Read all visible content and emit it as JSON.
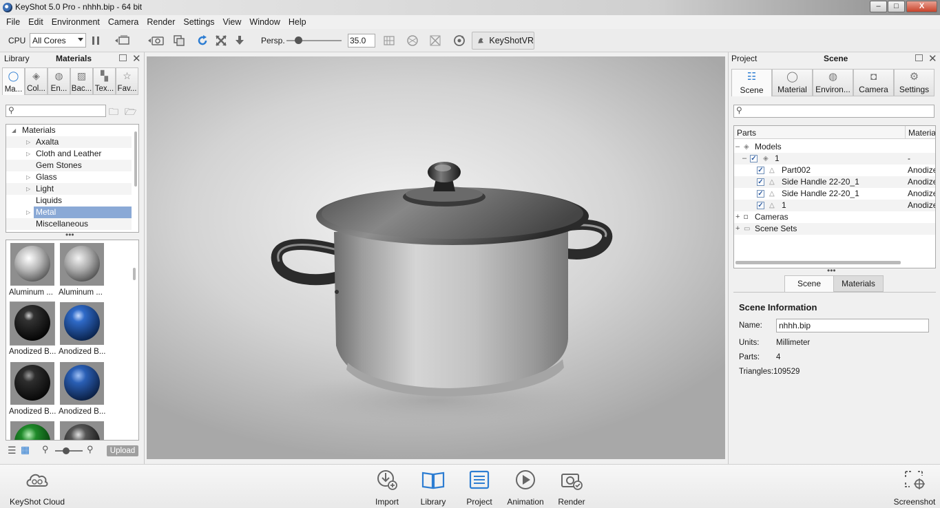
{
  "window": {
    "title": "KeyShot 5.0 Pro  - nhhh.bip  - 64 bit",
    "minimize": "–",
    "maximize": "□",
    "close": "X"
  },
  "menubar": [
    "File",
    "Edit",
    "Environment",
    "Camera",
    "Render",
    "Settings",
    "View",
    "Window",
    "Help"
  ],
  "toolbar": {
    "cpu_label": "CPU",
    "cpu_value": "All Cores",
    "persp_label": "Persp.",
    "persp_value": "35.0",
    "keyshotvr_label": "KeyShotVR"
  },
  "library": {
    "header_left": "Library",
    "header_center": "Materials",
    "tabs": [
      {
        "label": "Ma...",
        "icon": "material-icon"
      },
      {
        "label": "Col...",
        "icon": "colors-icon"
      },
      {
        "label": "En...",
        "icon": "environment-icon"
      },
      {
        "label": "Bac...",
        "icon": "backplate-icon"
      },
      {
        "label": "Tex...",
        "icon": "texture-icon"
      },
      {
        "label": "Fav...",
        "icon": "favorites-icon"
      }
    ],
    "tree": [
      {
        "label": "Materials",
        "level": 0,
        "arrow": "down"
      },
      {
        "label": "Axalta",
        "level": 1,
        "arrow": "right"
      },
      {
        "label": "Cloth and Leather",
        "level": 1,
        "arrow": "right"
      },
      {
        "label": "Gem Stones",
        "level": 1,
        "arrow": ""
      },
      {
        "label": "Glass",
        "level": 1,
        "arrow": "right"
      },
      {
        "label": "Light",
        "level": 1,
        "arrow": "right"
      },
      {
        "label": "Liquids",
        "level": 1,
        "arrow": ""
      },
      {
        "label": "Metal",
        "level": 1,
        "arrow": "right",
        "selected": true
      },
      {
        "label": "Miscellaneous",
        "level": 1,
        "arrow": ""
      }
    ],
    "thumbnails": [
      {
        "caption": "Aluminum ...",
        "color": "#c9c9c9"
      },
      {
        "caption": "Aluminum ...",
        "color": "#bdbdbd"
      },
      {
        "caption": "Anodized B...",
        "color": "#1a1a1a"
      },
      {
        "caption": "Anodized B...",
        "color": "#1d4f9e"
      },
      {
        "caption": "Anodized B...",
        "color": "#222222"
      },
      {
        "caption": "Anodized B...",
        "color": "#2557a8"
      },
      {
        "caption": "",
        "color": "#1f8a2a"
      },
      {
        "caption": "",
        "color": "#6f6f6f"
      }
    ],
    "upload_label": "Upload"
  },
  "project": {
    "header_left": "Project",
    "header_center": "Scene",
    "tabs": [
      {
        "label": "Scene",
        "icon": "scene-list-icon"
      },
      {
        "label": "Material",
        "icon": "material-icon"
      },
      {
        "label": "Environ...",
        "icon": "environment-icon"
      },
      {
        "label": "Camera",
        "icon": "camera-icon"
      },
      {
        "label": "Settings",
        "icon": "gear-icon"
      }
    ],
    "tree_header": {
      "parts": "Parts",
      "material": "Materia"
    },
    "tree": [
      {
        "name": "Models",
        "material": "",
        "level": 0
      },
      {
        "name": "1",
        "material": "-",
        "level": 1
      },
      {
        "name": "Part002",
        "material": "Anodize",
        "level": 2
      },
      {
        "name": "Side Handle 22-20_1",
        "material": "Anodize",
        "level": 2
      },
      {
        "name": "Side Handle 22-20_1",
        "material": "Anodize",
        "level": 2
      },
      {
        "name": "1",
        "material": "Anodize",
        "level": 2
      },
      {
        "name": "Cameras",
        "material": "",
        "level": 0
      },
      {
        "name": "Scene Sets",
        "material": "",
        "level": 0
      }
    ],
    "sub_tabs": {
      "scene": "Scene",
      "materials": "Materials"
    },
    "info": {
      "heading": "Scene Information",
      "name_label": "Name:",
      "name_value": "nhhh.bip",
      "units_label": "Units:",
      "units_value": "Millimeter",
      "parts_label": "Parts:",
      "parts_value": "4",
      "triangles_label": "Triangles:",
      "triangles_value": "109529"
    }
  },
  "dock": {
    "cloud": "KeyShot Cloud",
    "import": "Import",
    "library": "Library",
    "project": "Project",
    "animation": "Animation",
    "render": "Render",
    "screenshot": "Screenshot"
  },
  "colors": {
    "accent": "#2d7dd2",
    "selection": "#8aa9d6",
    "close_button": "#c9432b"
  }
}
